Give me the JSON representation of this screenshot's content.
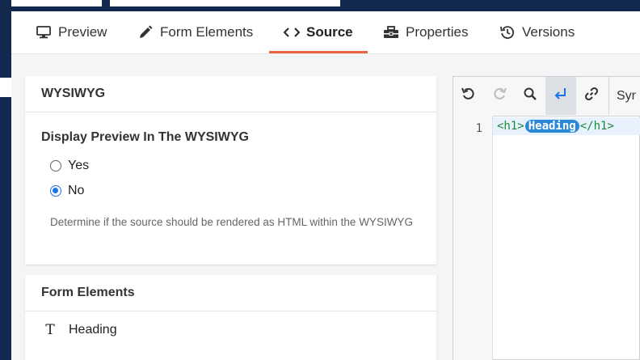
{
  "tabs": [
    {
      "label": "Preview",
      "icon": "monitor-icon"
    },
    {
      "label": "Form Elements",
      "icon": "pencil-icon"
    },
    {
      "label": "Source",
      "icon": "code-icon"
    },
    {
      "label": "Properties",
      "icon": "toolbox-icon"
    },
    {
      "label": "Versions",
      "icon": "history-icon"
    }
  ],
  "active_tab": "Source",
  "wysiwyg": {
    "header": "WYSIWYG",
    "title": "Display Preview In The WYSIWYG",
    "options": [
      {
        "label": "Yes",
        "checked": false
      },
      {
        "label": "No",
        "checked": true
      }
    ],
    "help": "Determine if the source should be rendered as HTML within the WYSIWYG"
  },
  "form_elements": {
    "header": "Form Elements",
    "items": [
      {
        "label": "Heading",
        "icon": "text-type-icon"
      }
    ]
  },
  "editor": {
    "toolbar_label": "Syr",
    "line_number": "1",
    "code": {
      "open_tag": "<h1>",
      "content": "Heading",
      "close_tag": "</h1>"
    }
  },
  "colors": {
    "accent": "#e8663d",
    "radio": "#1a73e8",
    "tag": "#1a8a3a",
    "highlight": "#2b88d8",
    "background_window": "#13294f"
  }
}
